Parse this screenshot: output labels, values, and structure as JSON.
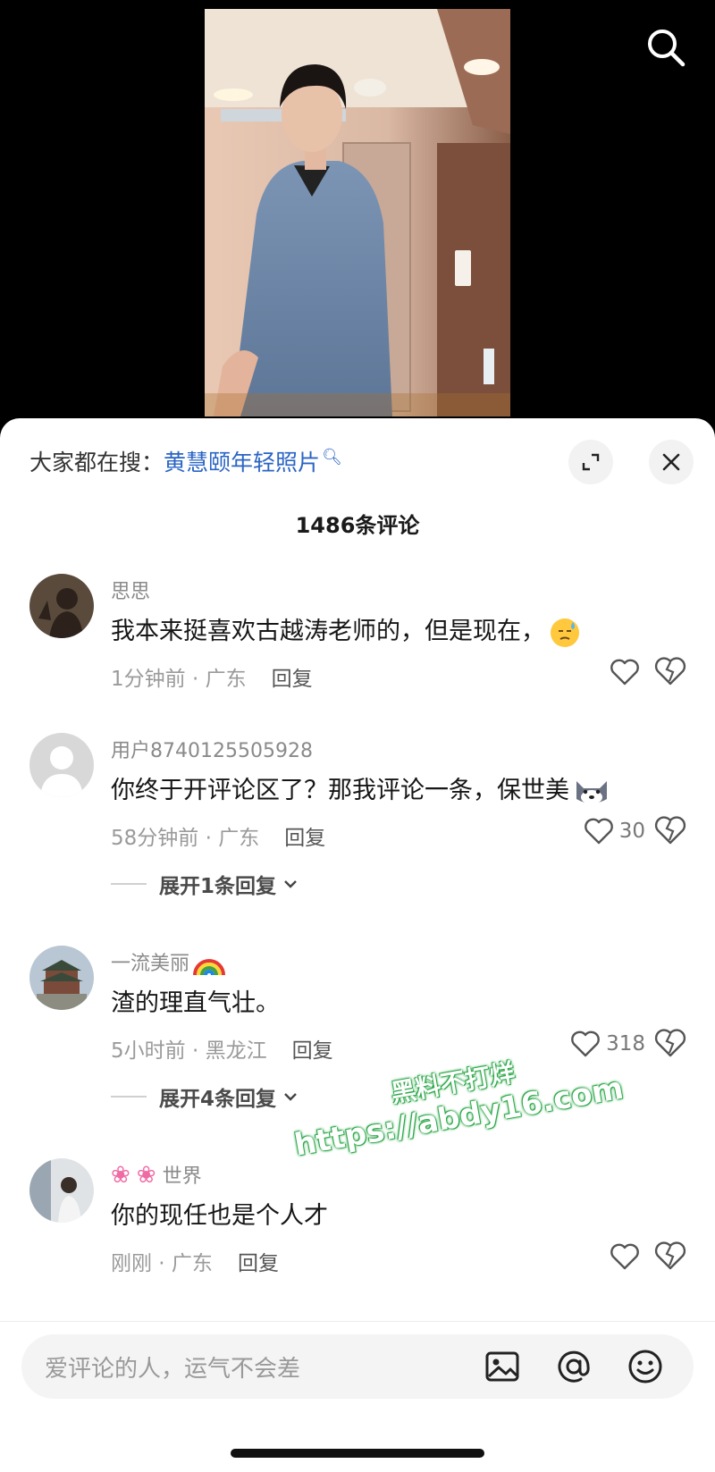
{
  "header": {
    "search_icon": "search-icon"
  },
  "sheet": {
    "trending_prefix": "大家都在搜：",
    "trending_query": "黄慧颐年轻照片",
    "comment_count": "1486条评论"
  },
  "comments": [
    {
      "user": "思思",
      "text": "我本来挺喜欢古越涛老师的，但是现在，",
      "time": "1分钟前 · 广东",
      "reply": "回复",
      "likes": ""
    },
    {
      "user": "用户8740125505928",
      "text": "你终于开评论区了？那我评论一条，保世美",
      "time": "58分钟前 · 广东",
      "reply": "回复",
      "likes": "30",
      "expand": "展开1条回复"
    },
    {
      "user": "一流美丽",
      "text": "渣的理直气壮。",
      "time": "5小时前 · 黑龙江",
      "reply": "回复",
      "likes": "318",
      "expand": "展开4条回复"
    },
    {
      "user": "世界",
      "text": "你的现任也是个人才",
      "time": "刚刚 · 广东",
      "reply": "回复",
      "likes": ""
    }
  ],
  "watermark": {
    "line1": "黑料不打烊",
    "line2": "https://abdy16.com"
  },
  "input": {
    "placeholder": "爱评论的人，运气不会差"
  },
  "colors": {
    "link": "#2a64c4",
    "watermark_outline": "#2ea84a"
  }
}
